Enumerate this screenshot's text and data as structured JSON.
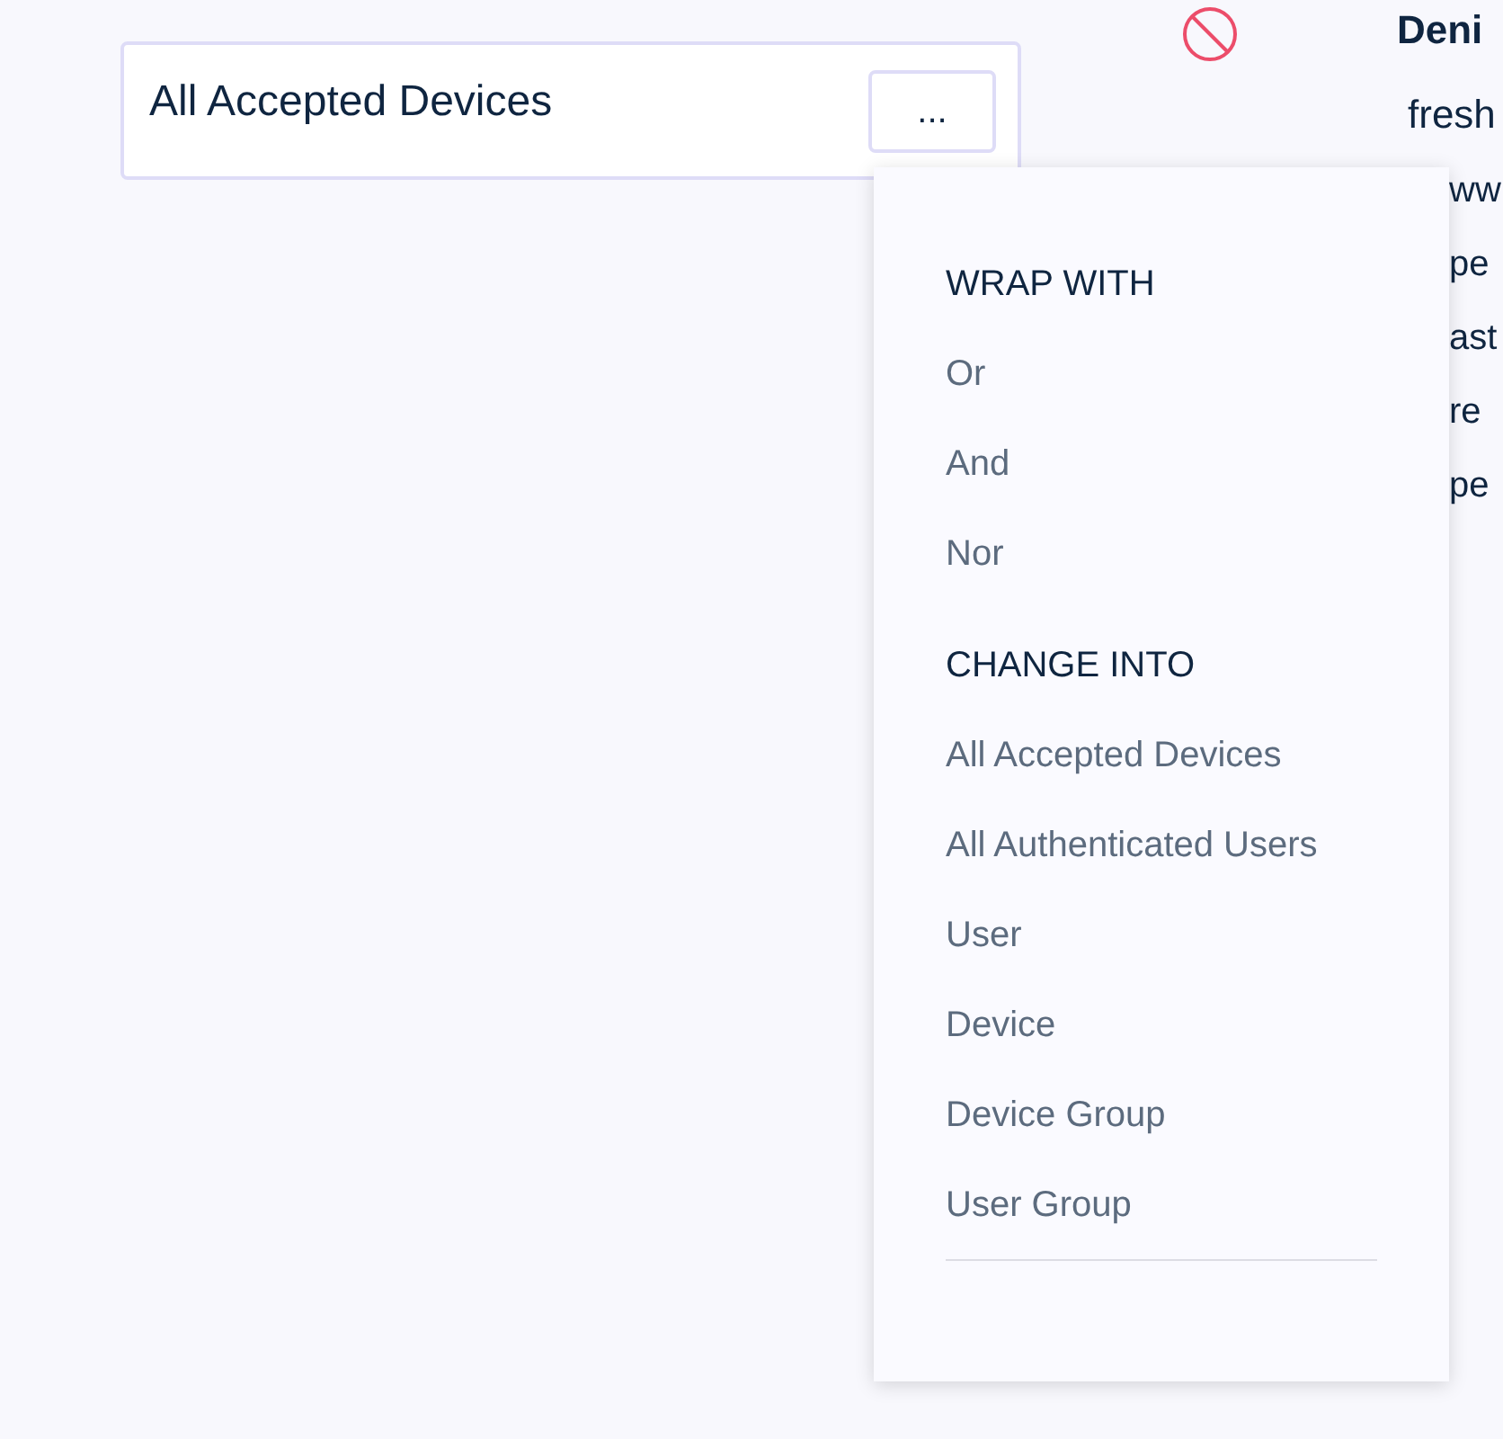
{
  "condition_card": {
    "label": "All Accepted Devices",
    "menu_button": "..."
  },
  "side_panel": {
    "title": "Deni",
    "lines": [
      "fresh",
      "ww",
      "pe",
      "ast",
      "re",
      "pe"
    ]
  },
  "menu": {
    "sections": [
      {
        "heading": "WRAP WITH",
        "items": [
          "Or",
          "And",
          "Nor"
        ]
      },
      {
        "heading": "CHANGE INTO",
        "items": [
          "All Accepted Devices",
          "All Authenticated Users",
          "User",
          "Device",
          "Device Group",
          "User Group"
        ]
      }
    ]
  }
}
